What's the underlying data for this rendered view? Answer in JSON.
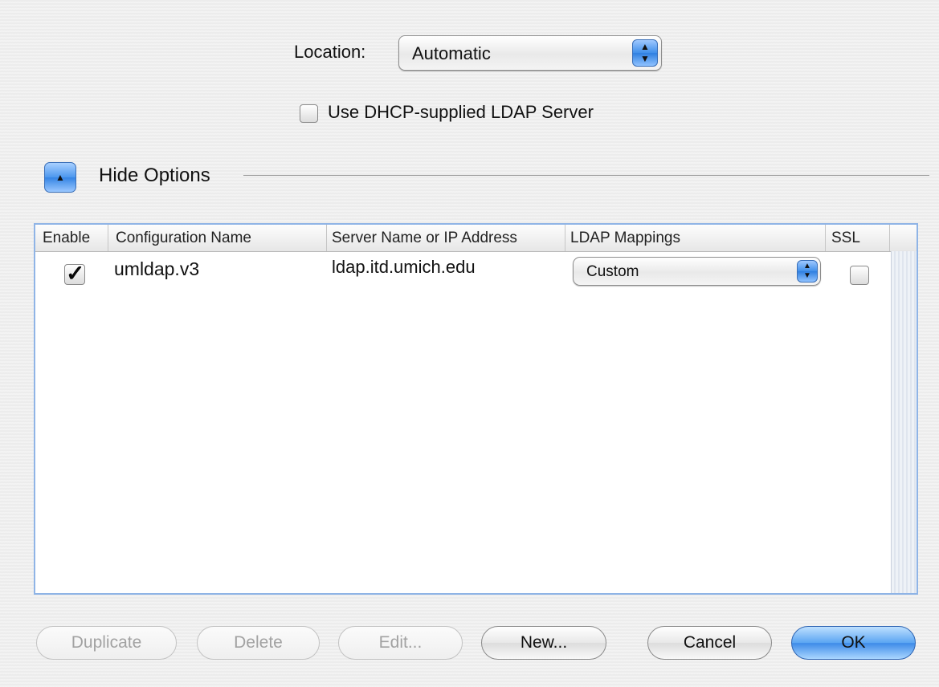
{
  "location": {
    "label": "Location:",
    "value": "Automatic"
  },
  "dhcp": {
    "label": "Use DHCP-supplied LDAP Server",
    "checked": false
  },
  "options": {
    "toggle_label": "Hide Options"
  },
  "table": {
    "columns": [
      "Enable",
      "Configuration Name",
      "Server Name or IP Address",
      "LDAP Mappings",
      "SSL"
    ],
    "rows": [
      {
        "enabled": true,
        "configuration_name": "umldap.v3",
        "server": "ldap.itd.umich.edu",
        "mapping": "Custom",
        "ssl": false
      }
    ]
  },
  "buttons": {
    "duplicate": "Duplicate",
    "delete": "Delete",
    "edit": "Edit...",
    "new": "New...",
    "cancel": "Cancel",
    "ok": "OK"
  },
  "colors": {
    "accent": "#3d8be8",
    "table_border": "#8fb4e6"
  },
  "icons": {
    "hide_options": "triangle-up-icon",
    "popup_arrows": "up-down-arrows-icon",
    "checkmark": "checkmark-icon"
  }
}
